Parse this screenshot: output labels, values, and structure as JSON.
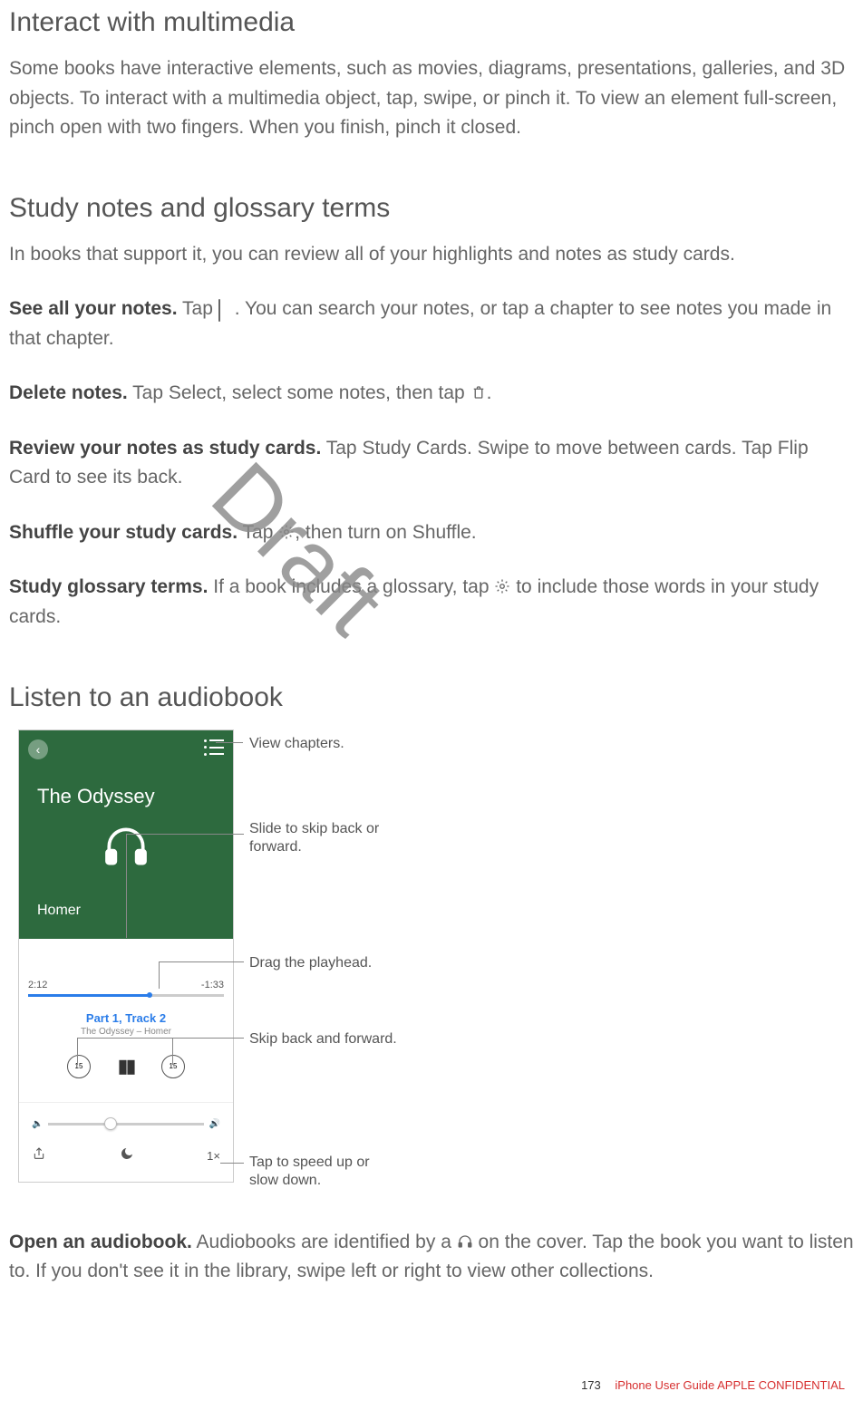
{
  "sections": {
    "multimedia": {
      "heading": "Interact with multimedia",
      "body": "Some books have interactive elements, such as movies, diagrams, presentations, galleries, and 3D objects. To interact with a multimedia object, tap, swipe, or pinch it. To view an element full-screen, pinch open with two fingers. When you finish, pinch it closed."
    },
    "study": {
      "heading": "Study notes and glossary terms",
      "intro": "In books that support it, you can review all of your highlights and notes as study cards.",
      "see_notes_label": "See all your notes.",
      "see_notes_a": " Tap ",
      "see_notes_b": ". You can search your notes, or tap a chapter to see notes you made in that chapter.",
      "delete_label": "Delete notes.",
      "delete_a": " Tap Select, select some notes, then tap ",
      "delete_b": ".",
      "review_label": "Review your notes as study cards.",
      "review_body": " Tap Study Cards. Swipe to move between cards. Tap Flip Card to see its back.",
      "shuffle_label": "Shuffle your study cards.",
      "shuffle_a": " Tap ",
      "shuffle_b": ", then turn on Shuffle.",
      "glossary_label": "Study glossary terms.",
      "glossary_a": " If a book includes a glossary, tap ",
      "glossary_b": " to include those words in your study cards."
    },
    "audiobook": {
      "heading": "Listen to an audiobook",
      "open_label": "Open an audiobook.",
      "open_a": " Audiobooks are identified by a ",
      "open_b": " on the cover. Tap the book you want to listen to. If you don't see it in the library, swipe left or right to view other collections."
    }
  },
  "figure": {
    "book_title": "The Odyssey",
    "author": "Homer",
    "time_elapsed": "2:12",
    "time_remaining": "-1:33",
    "track_title": "Part 1, Track 2",
    "track_sub": "The Odyssey – Homer",
    "skip_back": "15",
    "skip_fwd": "15",
    "speed": "1×",
    "callouts": {
      "chapters": "View chapters.",
      "slide": "Slide to skip back or forward.",
      "playhead": "Drag the playhead.",
      "skip": "Skip back and forward.",
      "speed": "Tap to speed up or slow down."
    }
  },
  "watermark": "Draft",
  "footer": {
    "page": "173",
    "text": "iPhone User Guide  APPLE CONFIDENTIAL"
  }
}
